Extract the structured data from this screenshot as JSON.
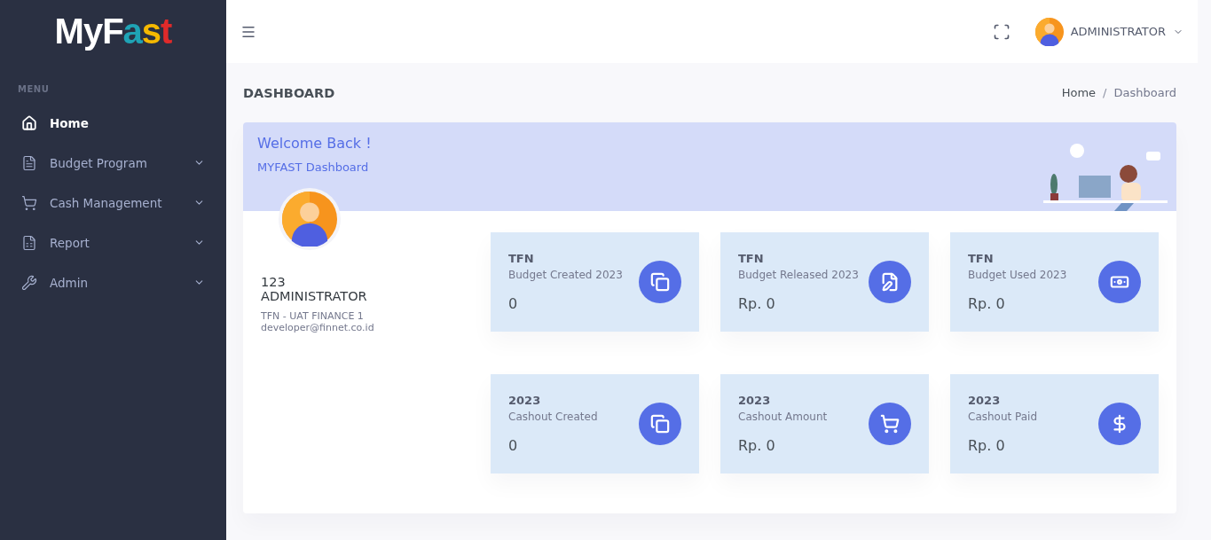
{
  "logo": [
    {
      "text": "MyF",
      "color": "#ffffff"
    },
    {
      "text": "a",
      "color": "#1fa3b5"
    },
    {
      "text": "s",
      "color": "#f5b800"
    },
    {
      "text": "t",
      "color": "#e02a2a"
    }
  ],
  "sidebar": {
    "heading": "MENU",
    "items": [
      {
        "label": "Home",
        "kind": "home",
        "selected": true,
        "expandable": false
      },
      {
        "label": "Budget Program",
        "kind": "document",
        "selected": false,
        "expandable": true
      },
      {
        "label": "Cash Management",
        "kind": "cart",
        "selected": false,
        "expandable": true
      },
      {
        "label": "Report",
        "kind": "report",
        "selected": false,
        "expandable": true
      },
      {
        "label": "Admin",
        "kind": "wrench",
        "selected": false,
        "expandable": true
      }
    ]
  },
  "header": {
    "user": "ADMINISTRATOR"
  },
  "page": {
    "title": "DASHBOARD",
    "separator": "/",
    "breadcrumb": [
      {
        "label": "Home",
        "selected": false
      },
      {
        "label": "Dashboard",
        "selected": true
      }
    ]
  },
  "welcome": {
    "title": "Welcome Back !",
    "subtitle": "MYFAST Dashboard"
  },
  "profile": {
    "id": "123",
    "name": "ADMINISTRATOR",
    "company": "TFN - UAT FINANCE 1",
    "email": "developer@finnet.co.id"
  },
  "stats": [
    {
      "heading": "TFN",
      "label": "Budget Created 2023",
      "value": "0",
      "kind": "copy"
    },
    {
      "heading": "TFN",
      "label": "Budget Released 2023",
      "value": "Rp. 0",
      "kind": "edit"
    },
    {
      "heading": "TFN",
      "label": "Budget Used 2023",
      "value": "Rp. 0",
      "kind": "money"
    },
    {
      "heading": "2023",
      "label": "Cashout Created",
      "value": "0",
      "kind": "copy"
    },
    {
      "heading": "2023",
      "label": "Cashout Amount",
      "value": "Rp. 0",
      "kind": "cart"
    },
    {
      "heading": "2023",
      "label": "Cashout Paid",
      "value": "Rp. 0",
      "kind": "dollar"
    }
  ]
}
